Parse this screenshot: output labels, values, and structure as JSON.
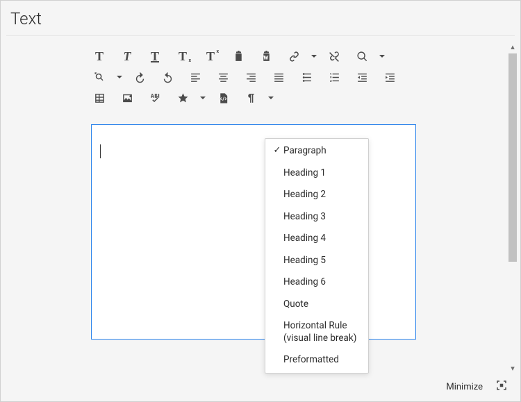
{
  "title": "Text",
  "footer": {
    "minimize": "Minimize"
  },
  "toolbar": {
    "bold": "B",
    "italic": "I",
    "underline": "U",
    "sub": "x",
    "sup": "x",
    "paste_text": "paste-text",
    "paste_word": "paste-word",
    "link": "link",
    "unlink": "unlink",
    "find": "find",
    "replace": "replace",
    "undo": "undo",
    "redo": "redo",
    "align_left": "left",
    "align_center": "center",
    "align_right": "right",
    "justify": "justify",
    "ul": "ul",
    "ol": "ol",
    "outdent": "outdent",
    "indent": "indent",
    "table": "table",
    "image": "image",
    "spell": "spell",
    "special": "special",
    "source": "source",
    "paraformat": "paraformat"
  },
  "format_menu": {
    "selected": "Paragraph",
    "items": [
      "Paragraph",
      "Heading 1",
      "Heading 2",
      "Heading 3",
      "Heading 4",
      "Heading 5",
      "Heading 6",
      "Quote",
      "Horizontal Rule (visual line break)",
      "Preformatted"
    ]
  }
}
